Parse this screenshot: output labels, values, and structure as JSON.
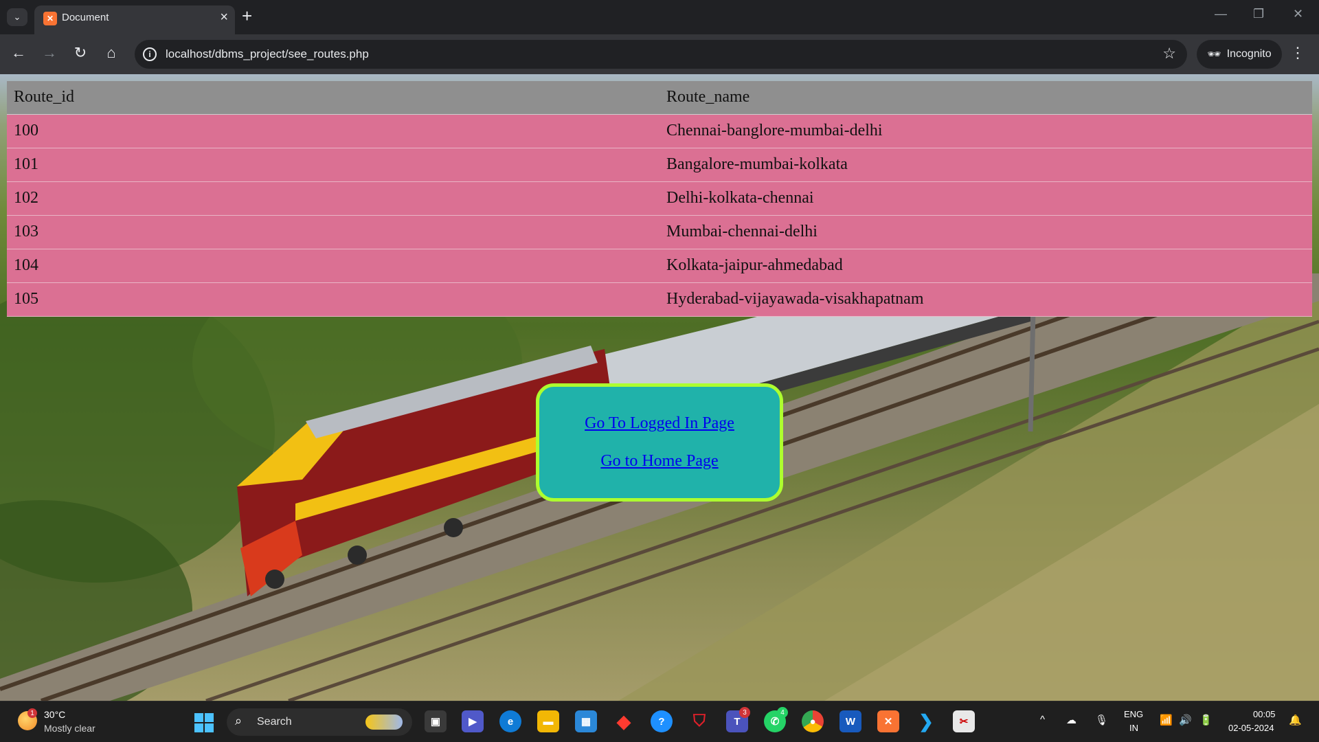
{
  "browser": {
    "tab_title": "Document",
    "tab_favicon": "xampp-icon",
    "url": "localhost/dbms_project/see_routes.php",
    "incognito_label": "Incognito"
  },
  "table": {
    "headers": [
      "Route_id",
      "Route_name"
    ],
    "rows": [
      {
        "id": "100",
        "name": "Chennai-banglore-mumbai-delhi"
      },
      {
        "id": "101",
        "name": "Bangalore-mumbai-kolkata"
      },
      {
        "id": "102",
        "name": "Delhi-kolkata-chennai"
      },
      {
        "id": "103",
        "name": "Mumbai-chennai-delhi"
      },
      {
        "id": "104",
        "name": "Kolkata-jaipur-ahmedabad"
      },
      {
        "id": "105",
        "name": "Hyderabad-vijayawada-visakhapatnam"
      }
    ]
  },
  "links": {
    "logged_in": "Go To Logged In Page",
    "home": "Go to Home Page"
  },
  "taskbar": {
    "weather_temp": "30°C",
    "weather_desc": "Mostly clear",
    "weather_badge": "1",
    "search_label": "Search",
    "teams_badge": "3",
    "whatsapp_badge": "4",
    "lang_top": "ENG",
    "lang_bottom": "IN",
    "time": "00:05",
    "date": "02-05-2024"
  },
  "colors": {
    "header_row": "#8f8f8f",
    "data_row": "#db7093",
    "linkbox_bg": "#20b2aa",
    "linkbox_border": "#adff2f",
    "link": "#0000ee"
  }
}
